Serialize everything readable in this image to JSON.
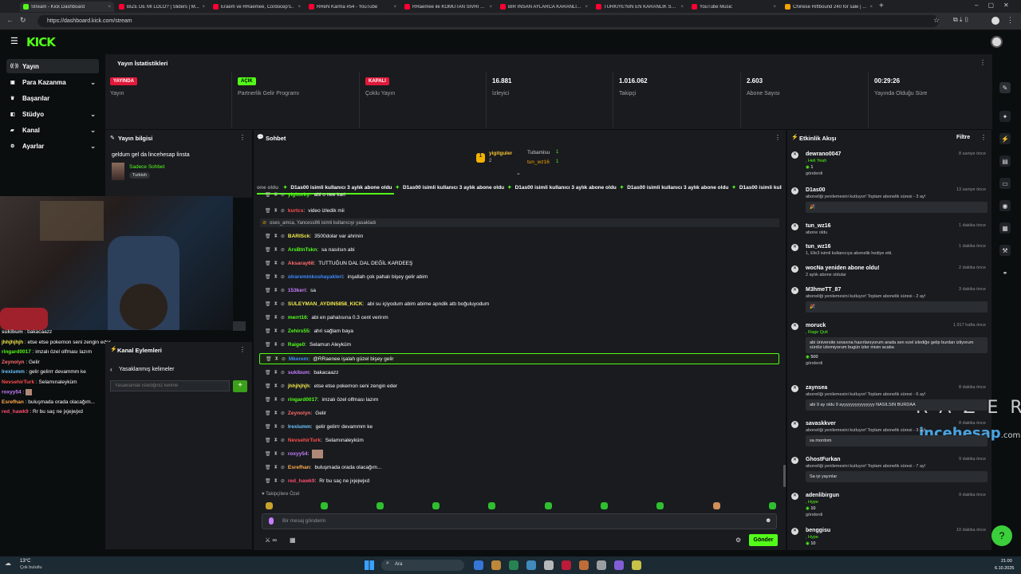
{
  "browser": {
    "tabs": [
      {
        "label": "Stream - Kick Dashboard",
        "color": "#53fc18"
      },
      {
        "label": "BİZE DE Mİ LOLO? | Sliders | M...",
        "color": "#ff0033"
      },
      {
        "label": "Eraem ve RRaemee, Cordocep's..",
        "color": "#ff0033"
      },
      {
        "label": "RReN Karma #54 - YouTube",
        "color": "#ff0033"
      },
      {
        "label": "RRaemee ile KOMUTAN SİVRİ HA...",
        "color": "#ff0033"
      },
      {
        "label": "BİR İNSAN AYLARCA KARANLIK...",
        "color": "#ff0033"
      },
      {
        "label": "TÜRKİYE'NİN EN KARANLIK SERİ...",
        "color": "#ff0033"
      },
      {
        "label": "YouTube Music",
        "color": "#ff0033"
      },
      {
        "label": "Chinese Riftbound 240 for sale | ...",
        "color": "#f4a300"
      }
    ],
    "url": "https://dashboard.kick.com/stream"
  },
  "logo": "KICK",
  "sidebar": {
    "items": [
      {
        "label": "Yayın",
        "icon": "broadcast-icon"
      },
      {
        "label": "Para Kazanma",
        "icon": "money-icon",
        "chevron": "⌄"
      },
      {
        "label": "Başarılar",
        "icon": "trophy-icon"
      },
      {
        "label": "Stüdyo",
        "icon": "studio-icon",
        "chevron": "⌄"
      },
      {
        "label": "Kanal",
        "icon": "channel-icon",
        "chevron": "⌄"
      },
      {
        "label": "Ayarlar",
        "icon": "gear-icon",
        "chevron": "⌄"
      }
    ]
  },
  "stats": {
    "title": "Yayın İstatistikleri",
    "items": [
      {
        "badge": "YAYINDA",
        "badge_color": "#e0193a",
        "label": "Yayın"
      },
      {
        "badge": "AÇIK",
        "badge_color": "#53fc18",
        "label": "Partnerlik Gelir Programı"
      },
      {
        "badge": "KAPALI",
        "badge_color": "#e0193a",
        "label": "Çoklu Yayın"
      },
      {
        "value": "16.881",
        "label": "İzleyici"
      },
      {
        "value": "1.016.062",
        "label": "Takipçi"
      },
      {
        "value": "2.603",
        "label": "Abone Sayısı"
      },
      {
        "value": "00:29:26",
        "label": "Yayında Olduğu Süre"
      }
    ]
  },
  "stream_info": {
    "title": "Yayın bilgisi",
    "stream_title": "geldum gel da lincehesap linsta",
    "category": "Sadece Sohbet",
    "tag": "Turkish"
  },
  "overlay_chat": [
    {
      "name": "sukibum",
      "text": "bakacaazz",
      "color": "#cfd1d4"
    },
    {
      "name": "jhhjhjhjh",
      "text": "etse etse pokemon seni zengin eder",
      "color": "#f2e94e"
    },
    {
      "name": "ringard0017",
      "text": "imzalı özel olfması lazım",
      "color": "#53fc18"
    },
    {
      "name": "Zeynolyn",
      "text": "Gelir",
      "color": "#ff6b6b"
    },
    {
      "name": "lrexiumm",
      "text": "gelir gelirrr devammm ke",
      "color": "#6bc5ff"
    },
    {
      "name": "NevsehirTurk",
      "text": "Selamınaleyküm",
      "color": "#ff4d4d"
    },
    {
      "name": "roxyy54",
      "text": "",
      "color": "#c77dff"
    },
    {
      "name": "Esrefhan",
      "text": "buluşmada orada olacağım...",
      "color": "#ffa94d"
    },
    {
      "name": "red_hawk9",
      "text": "Rr bu saç ne jxjejwjxd",
      "color": "#ff4d6d"
    }
  ],
  "channel_actions": {
    "title": "Kanal Eylemleri",
    "back_label": "Yasaklanmış kelimeler",
    "input_placeholder": "Yasaklamak istediğiniz kelime",
    "add_label": "+"
  },
  "chat": {
    "title": "Sohbet",
    "top_gifters": [
      {
        "name": "yigitguler",
        "count": "2"
      },
      {
        "name": "Tubamisu",
        "count": "1"
      },
      {
        "name": "tun_wz16",
        "count": "1"
      }
    ],
    "ticker": "D1as00 isimli kullanıcı 3 aylık abone oldu",
    "ticker_prefix": "one oldu",
    "ban_notice": "oses_amca, Yancess86 isimli kullanıcıyı yasakladı",
    "messages": [
      {
        "name": "yigitorky",
        "text": "abi o nee karl",
        "color": "#53fc18"
      },
      {
        "name": "kurtcs",
        "text": "video izledik mii",
        "color": "#ff4d4d"
      },
      {
        "name": "BARISck",
        "text": "3500dolar var ahrinin",
        "color": "#f2e94e"
      },
      {
        "name": "ArsBtnTskn",
        "text": "sa nasılsın abi",
        "color": "#53fc18"
      },
      {
        "name": "Aksaray68",
        "text": "TUTTUĞUN DAL DAL DEĞİL KARDEEŞ",
        "color": "#ff6b6b"
      },
      {
        "name": "olrareminkoshayakleri",
        "text": "inşallah çok pahalı bişey gelir abim",
        "color": "#3d8bff"
      },
      {
        "name": "153keri",
        "text": "sa",
        "color": "#c77dff"
      },
      {
        "name": "SULEYMAN_AYDIN5858_KICK",
        "text": "abi su içiyodum abim abime apndik attı boğuluyodum",
        "color": "#f2e94e"
      },
      {
        "name": "merrt16",
        "text": "abi en pahalısına 0.3 cent verirım",
        "color": "#53fc18"
      },
      {
        "name": "Zehirs55",
        "text": "ahri sağlam baya",
        "color": "#53fc18"
      },
      {
        "name": "Raige0",
        "text": "Selamun Aleyküm",
        "color": "#53fc18"
      },
      {
        "name": "Mkerem",
        "text": "@RRaenee işalah güzel bişey gelir",
        "color": "#3d8bff"
      },
      {
        "name": "sukibum",
        "text": "bakacaazz",
        "color": "#c77dff"
      },
      {
        "name": "jhhjhjhjh",
        "text": "etse etse pokemon seni zengin eder",
        "color": "#f2e94e"
      },
      {
        "name": "ringard0017",
        "text": "imzalı özel olfması lazım",
        "color": "#53fc18"
      },
      {
        "name": "Zeynolyn",
        "text": "Gelir",
        "color": "#ff6b6b"
      },
      {
        "name": "lrexiumm",
        "text": "gelir gelirrr devammm ke",
        "color": "#6bc5ff"
      },
      {
        "name": "NevsehirTurk",
        "text": "Selamınaleyküm",
        "color": "#ff4d4d"
      },
      {
        "name": "roxyy54",
        "text": "",
        "color": "#c77dff"
      },
      {
        "name": "Esrefhan",
        "text": "buluşmada orada olacağım...",
        "color": "#ffa94d"
      },
      {
        "name": "red_hawk9",
        "text": "Rr bu saç ne jxjejwjxd",
        "color": "#ff4d6d"
      }
    ],
    "follower_only": "Takipçilere Özel",
    "input_placeholder": "Bir mesaj gönderin",
    "send_label": "Gönder"
  },
  "activity": {
    "title": "Etkinlik Akışı",
    "filter_label": "Filtre",
    "items": [
      {
        "name": "dewrano0047",
        "time": "8 saniye önce",
        "sub": ", Heli Yeah",
        "extra": "1",
        "extra2": "gönderdi"
      },
      {
        "name": "D1as00",
        "time": "13 saniye önce",
        "sub": "aboneliği yenilemesini kutluyor! Toplam abonelik süresi - 3 ay!",
        "box": "🎉"
      },
      {
        "name": "tun_wz16",
        "time": "1 dakika önce",
        "sub": "abone oldu"
      },
      {
        "name": "tun_wz16",
        "time": "1 dakika önce",
        "sub": "1, Efe3 isimli kullanıcıya abonelik hediye etti."
      },
      {
        "name": "wocNa yeniden abone oldu!",
        "time": "2 dakika önce",
        "sub": "2 aylık abone oldular"
      },
      {
        "name": "M3hmeTT_87",
        "time": "3 dakika önce",
        "sub": "aboneliği yenilemesini kutluyor! Toplam abonelik süresi - 2 ay!",
        "box": "🎉"
      },
      {
        "name": "moruck",
        "time": "1.917 hafta önce",
        "sub": ", Rage Quit",
        "box": "abi üniversite sınavına hazırlanıyorum arada sen ezel izlediğe gelip burdan izliyorum sürdür izlemiyorum bugün izler misin acaba",
        "extra": "500",
        "extra2": "gönderdi"
      },
      {
        "name": "zaynsea",
        "time": "8 dakika önce",
        "sub": "aboneliği yenilemesini kutluyor! Toplam abonelik süresi - 6 ay!",
        "box": "abi 9 ay oldu 9 ayyyyyyyyyyyyyyy NASILSIN BURDAA"
      },
      {
        "name": "savaskkver",
        "time": "8 dakika önce",
        "sub": "aboneliği yenilemesini kutluyor! Toplam abonelik süresi - 3 ay!",
        "box": "sa mordom"
      },
      {
        "name": "GhostFurkan",
        "time": "9 dakika önce",
        "sub": "aboneliği yenilemesini kutluyor! Toplam abonelik süresi - 7 ay!",
        "box": "Sa iyi yayınlar"
      },
      {
        "name": "adenlibirgun",
        "time": "9 dakika önce",
        "sub": ", Hype",
        "extra": "10",
        "extra2": "gönderdi"
      },
      {
        "name": "benggisu",
        "time": "10 dakika önce",
        "sub": ", Hype",
        "extra": "10"
      }
    ]
  },
  "watermarks": {
    "razer": "RAZER",
    "brand1": "ince",
    "brand2": "hesap",
    "brand3": ".com"
  },
  "taskbar": {
    "weather": "13°C",
    "weather_sub": "Çok bulutlu",
    "search": "Ara",
    "time": "21:00",
    "date": "6.10.2025"
  }
}
